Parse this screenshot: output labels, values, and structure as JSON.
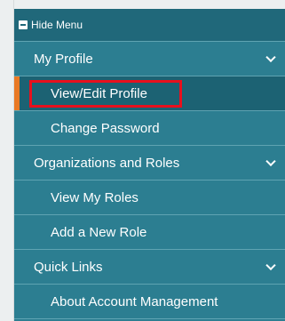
{
  "hide_menu": {
    "label": "Hide Menu",
    "icon": "minus-square-icon"
  },
  "sections": [
    {
      "label": "My Profile",
      "icon": "chevron-down-icon",
      "items": [
        {
          "label": "View/Edit Profile",
          "active": true
        },
        {
          "label": "Change Password"
        }
      ]
    },
    {
      "label": "Organizations and Roles",
      "icon": "chevron-down-icon",
      "items": [
        {
          "label": "View My Roles"
        },
        {
          "label": "Add a New Role"
        }
      ]
    },
    {
      "label": "Quick Links",
      "icon": "chevron-down-icon",
      "items": [
        {
          "label": "About Account Management"
        }
      ]
    }
  ],
  "colors": {
    "menu_bg": "#2c7e91",
    "header_bg": "#20687a",
    "active_bg": "#1c6273",
    "active_marker": "#e97924",
    "highlight_outline": "#e8101d"
  }
}
